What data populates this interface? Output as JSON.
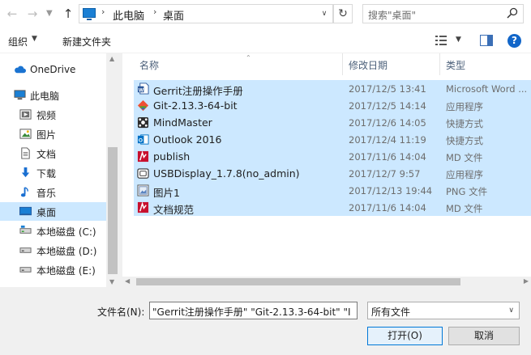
{
  "address_bar": {
    "back_icon": "arrow-left",
    "forward_icon": "arrow-right",
    "recent_icon": "chevron-down",
    "up_icon": "arrow-up",
    "breadcrumbs": [
      "此电脑",
      "桌面"
    ],
    "search_placeholder": "搜索\"桌面\""
  },
  "toolbar": {
    "organize": "组织",
    "new_folder": "新建文件夹"
  },
  "sidebar": {
    "items": [
      {
        "label": "OneDrive",
        "icon": "cloud-icon"
      },
      {
        "label": "此电脑",
        "icon": "computer-icon"
      },
      {
        "label": "视频",
        "icon": "video-icon"
      },
      {
        "label": "图片",
        "icon": "pictures-icon"
      },
      {
        "label": "文档",
        "icon": "documents-icon"
      },
      {
        "label": "下载",
        "icon": "download-icon"
      },
      {
        "label": "音乐",
        "icon": "music-icon"
      },
      {
        "label": "桌面",
        "icon": "desktop-icon",
        "selected": true
      },
      {
        "label": "本地磁盘 (C:)",
        "icon": "drive-icon"
      },
      {
        "label": "本地磁盘 (D:)",
        "icon": "drive-icon"
      },
      {
        "label": "本地磁盘 (E:)",
        "icon": "drive-icon"
      }
    ]
  },
  "filelist": {
    "columns": [
      "名称",
      "修改日期",
      "类型"
    ],
    "rows": [
      {
        "name": "Gerrit注册操作手册",
        "date": "2017/12/5 13:41",
        "type": "Microsoft Word ...",
        "icon": "word-doc-icon"
      },
      {
        "name": "Git-2.13.3-64-bit",
        "date": "2017/12/5 14:14",
        "type": "应用程序",
        "icon": "git-installer-icon"
      },
      {
        "name": "MindMaster",
        "date": "2017/12/6 14:05",
        "type": "快捷方式",
        "icon": "mindmaster-icon"
      },
      {
        "name": "Outlook 2016",
        "date": "2017/12/4 11:19",
        "type": "快捷方式",
        "icon": "outlook-icon"
      },
      {
        "name": "publish",
        "date": "2017/11/6 14:04",
        "type": "MD 文件",
        "icon": "md-file-icon"
      },
      {
        "name": "USBDisplay_1.7.8(no_admin)",
        "date": "2017/12/7 9:57",
        "type": "应用程序",
        "icon": "usb-app-icon"
      },
      {
        "name": "图片1",
        "date": "2017/12/13 19:44",
        "type": "PNG 文件",
        "icon": "png-file-icon"
      },
      {
        "name": "文档规范",
        "date": "2017/11/6 14:04",
        "type": "MD 文件",
        "icon": "md-file-icon"
      }
    ]
  },
  "bottom": {
    "filename_label": "文件名(N):",
    "filename_value": "\"Gerrit注册操作手册\" \"Git-2.13.3-64-bit\" \"I",
    "filetype_value": "所有文件",
    "open_label": "打开(O)",
    "cancel_label": "取消"
  },
  "colors": {
    "selection": "#cce8ff",
    "accent": "#0078d7",
    "help": "#1266c9"
  }
}
